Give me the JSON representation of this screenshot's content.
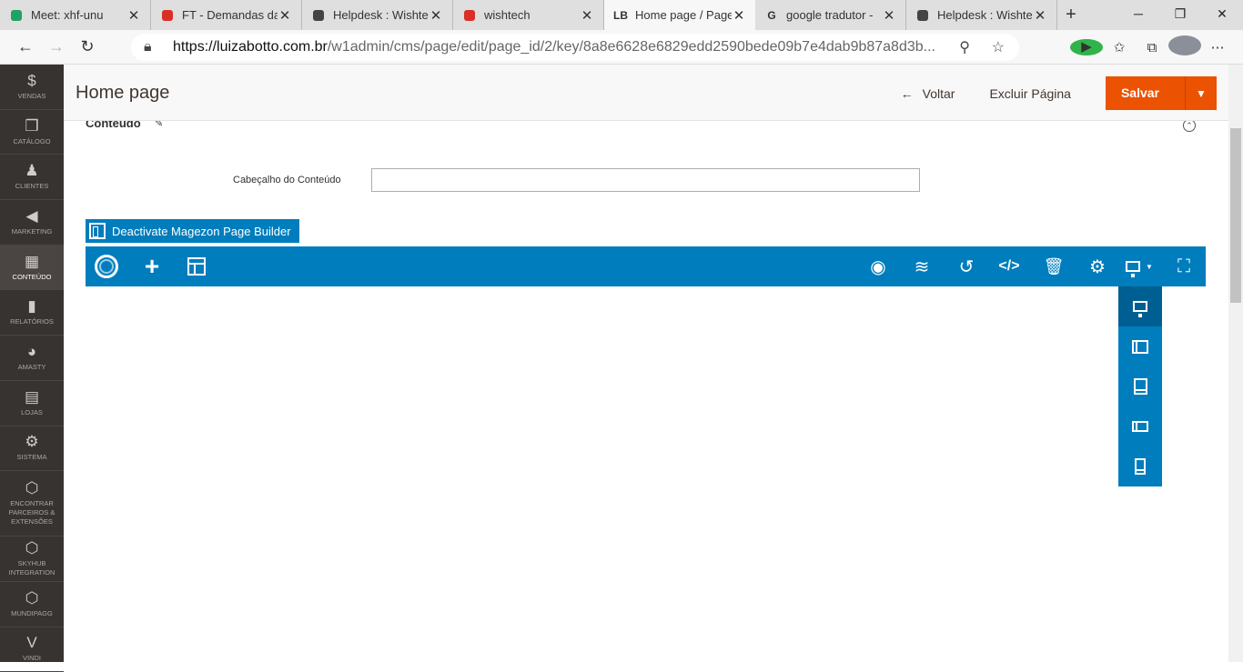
{
  "browser": {
    "tabs": [
      {
        "title": "Meet: xhf-unu",
        "icon": "meet-icon"
      },
      {
        "title": "FT - Demandas da",
        "icon": "gmail-icon"
      },
      {
        "title": "Helpdesk : Wishte",
        "icon": "helpdesk-icon"
      },
      {
        "title": "wishtech",
        "icon": "chat-icon"
      },
      {
        "title": "Home page / Page",
        "icon": "lb-icon",
        "fav_text": "LB"
      },
      {
        "title": "google tradutor -",
        "icon": "google-icon",
        "fav_text": "G"
      },
      {
        "title": "Helpdesk : Wishte",
        "icon": "helpdesk-icon"
      }
    ],
    "url_domain": "https://luizabotto.com.br",
    "url_path": "/w1admin/cms/page/edit/page_id/2/key/8a8e6628e6829edd2590bede09b7e4dab9b87a8d3b..."
  },
  "sidebar": {
    "items": [
      {
        "label": "Vendas",
        "icon": "dollar-icon",
        "glyph": "$"
      },
      {
        "label": "Catálogo",
        "icon": "box-icon",
        "glyph": "❒"
      },
      {
        "label": "Clientes",
        "icon": "person-icon",
        "glyph": "♟"
      },
      {
        "label": "Marketing",
        "icon": "megaphone-icon",
        "glyph": "◀"
      },
      {
        "label": "Conteúdo",
        "icon": "content-icon",
        "glyph": "▦",
        "active": true
      },
      {
        "label": "Relatórios",
        "icon": "bar-chart-icon",
        "glyph": "▮"
      },
      {
        "label": "Amasty",
        "icon": "amasty-icon",
        "glyph": "◕"
      },
      {
        "label": "Lojas",
        "icon": "store-icon",
        "glyph": "▤"
      },
      {
        "label": "Sistema",
        "icon": "gear-icon",
        "glyph": "⚙"
      },
      {
        "label": "Encontrar Parceiros & Extensões",
        "icon": "cube-icon",
        "glyph": "⬡",
        "tall": true
      },
      {
        "label": "SkyHub Integration",
        "icon": "hexagon-icon",
        "glyph": "⬡"
      },
      {
        "label": "Mundipagg",
        "icon": "hexagon-icon",
        "glyph": "⬡"
      },
      {
        "label": "Vindi",
        "icon": "vindi-icon",
        "glyph": "V"
      }
    ]
  },
  "header": {
    "title": "Home page",
    "back_label": "Voltar",
    "delete_label": "Excluir Página",
    "save_label": "Salvar"
  },
  "section": {
    "title": "Conteúdo",
    "field_label": "Cabeçalho do Conteúdo",
    "field_value": ""
  },
  "builder": {
    "deactivate_label": "Deactivate Magezon Page Builder"
  }
}
